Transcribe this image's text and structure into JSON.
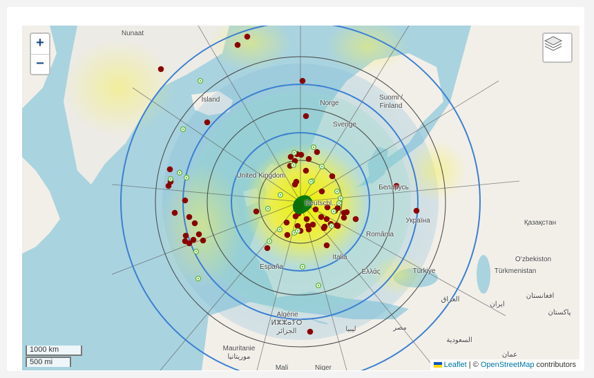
{
  "zoom": {
    "in_label": "+",
    "out_label": "−"
  },
  "layers": {
    "icon": "layers-icon"
  },
  "scale": {
    "km_label": "1000 km",
    "mi_label": "500 mi"
  },
  "attribution": {
    "leaflet": "Leaflet",
    "separator": " | © ",
    "osm": "OpenStreetMap",
    "suffix": " contributors"
  },
  "labels": [
    {
      "key": "nunaat",
      "text": "Nunaat"
    },
    {
      "key": "island",
      "text": "Ísland"
    },
    {
      "key": "norge",
      "text": "Norge"
    },
    {
      "key": "suomi1",
      "text": "Suomi /"
    },
    {
      "key": "suomi2",
      "text": "Finland"
    },
    {
      "key": "sverige",
      "text": "Sverige"
    },
    {
      "key": "uk",
      "text": "United Kingdom"
    },
    {
      "key": "belarus",
      "text": "Беларусь"
    },
    {
      "key": "deutsch",
      "text": "Deutschl..."
    },
    {
      "key": "ukraina",
      "text": "Україна"
    },
    {
      "key": "kazakhstan",
      "text": "Қазақстан"
    },
    {
      "key": "romania",
      "text": "România"
    },
    {
      "key": "italia",
      "text": "Italia"
    },
    {
      "key": "espana",
      "text": "España"
    },
    {
      "key": "ellas",
      "text": "Ελλάς"
    },
    {
      "key": "turkiye",
      "text": "Türkiye"
    },
    {
      "key": "uzbek",
      "text": "O‘zbekiston"
    },
    {
      "key": "turkmen",
      "text": "Türkmenistan"
    },
    {
      "key": "iraq",
      "text": "العراق"
    },
    {
      "key": "iran",
      "text": "ایران"
    },
    {
      "key": "afghan",
      "text": "افغانستان"
    },
    {
      "key": "pakistan",
      "text": "پاکستان"
    },
    {
      "key": "algerie1",
      "text": "Algérie"
    },
    {
      "key": "algerie2",
      "text": "ⵍⵣⵣⴰⵢⵔ"
    },
    {
      "key": "algerie3",
      "text": "الجزائر"
    },
    {
      "key": "libya",
      "text": "ليبيا"
    },
    {
      "key": "misr",
      "text": "مصر"
    },
    {
      "key": "saudi",
      "text": "السعودية"
    },
    {
      "key": "mauritanie1",
      "text": "Mauritanie"
    },
    {
      "key": "mauritanie2",
      "text": "موريتانيا"
    },
    {
      "key": "mali",
      "text": "Mali"
    },
    {
      "key": "niger",
      "text": "Niger"
    },
    {
      "key": "oman",
      "text": "عمان"
    }
  ],
  "colors": {
    "sea": "#a9d3df",
    "land": "#f2efe9",
    "ring_outer": "#3b7fd1",
    "ring_inner": "#444444",
    "station_marker": "#8b0000",
    "spot_marker": "#5fb53a",
    "home_marker": "#0a7a0a",
    "heat_yellow": "#f5f060"
  }
}
